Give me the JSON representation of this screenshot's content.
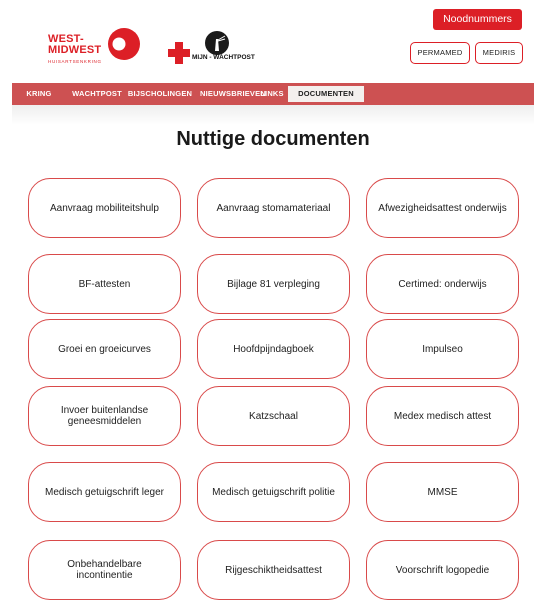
{
  "header": {
    "emergency_label": "Noodnummers",
    "brand": {
      "line1": "WEST-",
      "line2": "MIDWEST",
      "subtitle": "HUISARTSENKRING"
    },
    "partner": {
      "text": "MIJN - WACHTPOST"
    },
    "links": {
      "permamed": "PERMAMED",
      "mediris": "MEDIRIS"
    }
  },
  "nav": {
    "items": [
      "KRING",
      "WACHTPOST",
      "BIJSCHOLINGEN",
      "NIEUWSBRIEVEN",
      "LINKS",
      "DOCUMENTEN"
    ],
    "active": "DOCUMENTEN"
  },
  "main": {
    "title": "Nuttige documenten",
    "documents": [
      "Aanvraag mobiliteitshulp",
      "Aanvraag stomamateriaal",
      "Afwezigheidsattest onderwijs",
      "BF-attesten",
      "Bijlage 81 verpleging",
      "Certimed: onderwijs",
      "Groei en groeicurves",
      "Hoofdpijndagboek",
      "Impulseo",
      "Invoer buitenlandse geneesmiddelen",
      "Katzschaal",
      "Medex medisch attest",
      "Medisch getuigschrift leger",
      "Medisch getuigschrift politie",
      "MMSE",
      "Onbehandelbare incontinentie",
      "Rijgeschiktheidsattest",
      "Voorschrift logopedie"
    ]
  },
  "colors": {
    "brand_red": "#dc1f26",
    "nav_bg": "#cd5152",
    "button_border": "#d94a4a"
  }
}
